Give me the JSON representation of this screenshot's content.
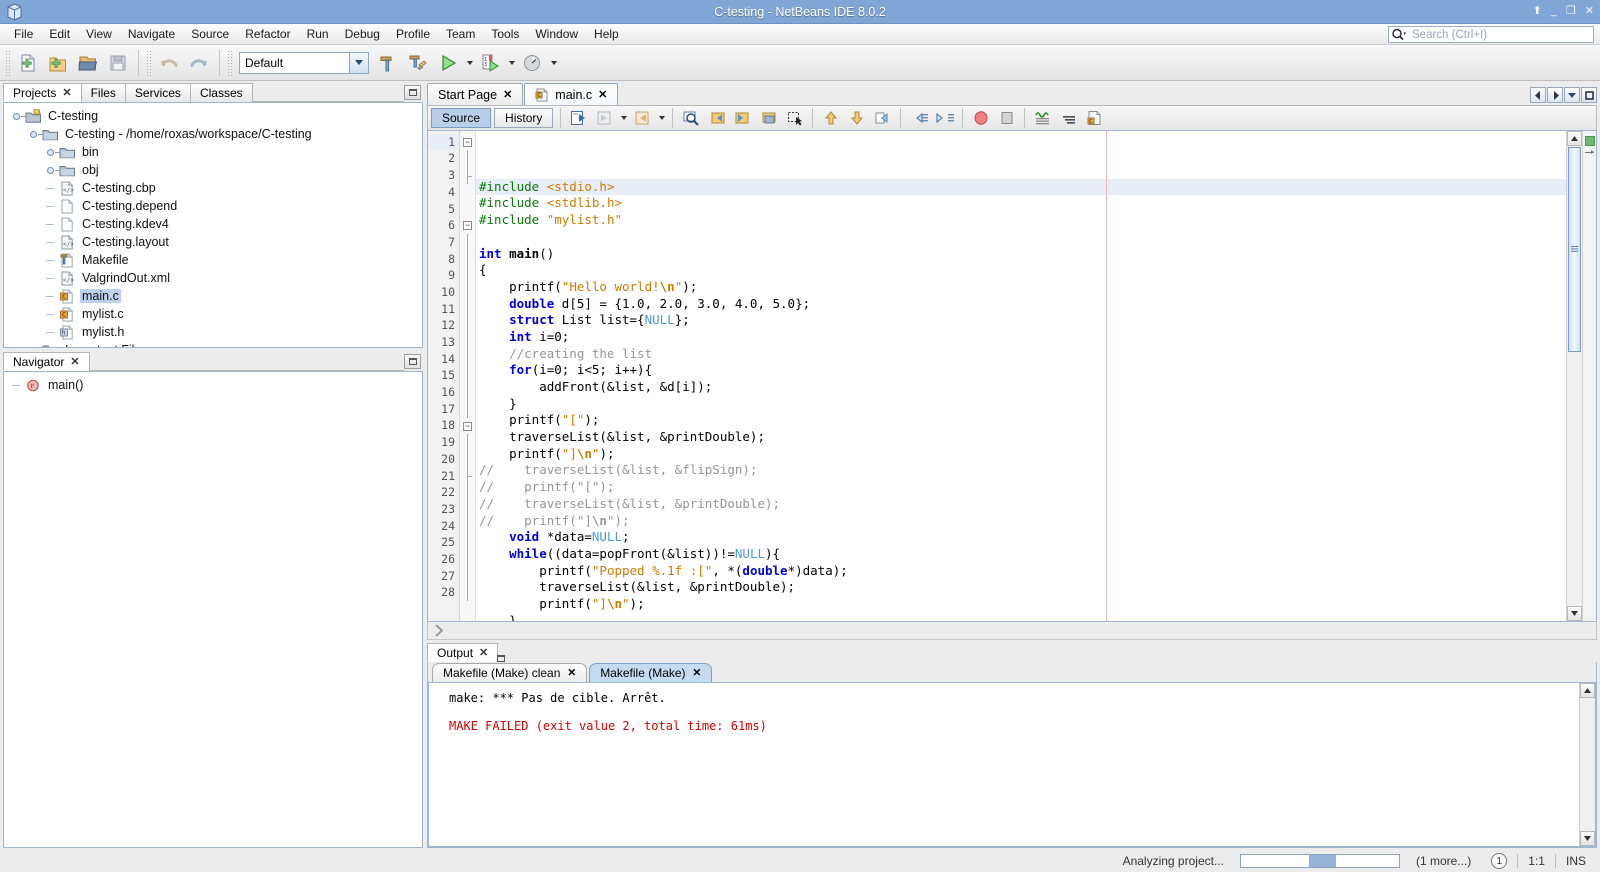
{
  "window": {
    "title": "C-testing - NetBeans IDE 8.0.2",
    "controls": {
      "up": "⬆",
      "minimize": "_",
      "restore": "❐",
      "close": "✕"
    }
  },
  "menubar": {
    "items": [
      {
        "label": "File",
        "mn": "F"
      },
      {
        "label": "Edit",
        "mn": "E"
      },
      {
        "label": "View",
        "mn": "V"
      },
      {
        "label": "Navigate",
        "mn": "N"
      },
      {
        "label": "Source",
        "mn": "S"
      },
      {
        "label": "Refactor",
        "mn": "a"
      },
      {
        "label": "Run",
        "mn": "R"
      },
      {
        "label": "Debug",
        "mn": "D"
      },
      {
        "label": "Profile",
        "mn": "P"
      },
      {
        "label": "Team",
        "mn": "m"
      },
      {
        "label": "Tools",
        "mn": "T"
      },
      {
        "label": "Window",
        "mn": "W"
      },
      {
        "label": "Help",
        "mn": "H"
      }
    ]
  },
  "search": {
    "placeholder": "Search (Ctrl+I)",
    "value": ""
  },
  "toolbar": {
    "config_combo": {
      "value": "Default"
    },
    "buttons": [
      {
        "name": "new-file",
        "tooltip": "New File"
      },
      {
        "name": "new-project",
        "tooltip": "New Project"
      },
      {
        "name": "open-project",
        "tooltip": "Open Project"
      },
      {
        "name": "save-all",
        "tooltip": "Save All"
      },
      {
        "name": "undo",
        "tooltip": "Undo"
      },
      {
        "name": "redo",
        "tooltip": "Redo"
      },
      {
        "name": "build-project",
        "tooltip": "Build Project"
      },
      {
        "name": "clean-and-build",
        "tooltip": "Clean and Build Project"
      },
      {
        "name": "run-project",
        "tooltip": "Run Project"
      },
      {
        "name": "debug-project",
        "tooltip": "Debug Project"
      },
      {
        "name": "profile-project",
        "tooltip": "Profile Project"
      }
    ]
  },
  "left": {
    "tabs": [
      {
        "label": "Projects",
        "closable": true,
        "selected": true
      },
      {
        "label": "Files",
        "closable": false,
        "selected": false
      },
      {
        "label": "Services",
        "closable": false,
        "selected": false
      },
      {
        "label": "Classes",
        "closable": false,
        "selected": false
      }
    ],
    "tree": [
      {
        "label": "C-testing",
        "depth": 0,
        "icon": "project-icon",
        "expander": "expanded",
        "selected": false
      },
      {
        "label": "C-testing - /home/roxas/workspace/C-testing",
        "depth": 1,
        "icon": "folder-icon",
        "expander": "expanded",
        "selected": false
      },
      {
        "label": "bin",
        "depth": 2,
        "icon": "folder-icon",
        "expander": "collapsed",
        "selected": false
      },
      {
        "label": "obj",
        "depth": 2,
        "icon": "folder-icon",
        "expander": "collapsed",
        "selected": false
      },
      {
        "label": "C-testing.cbp",
        "depth": 2,
        "icon": "xml-file-icon",
        "expander": "leaf",
        "selected": false
      },
      {
        "label": "C-testing.depend",
        "depth": 2,
        "icon": "plain-file-icon",
        "expander": "leaf",
        "selected": false
      },
      {
        "label": "C-testing.kdev4",
        "depth": 2,
        "icon": "plain-file-icon",
        "expander": "leaf",
        "selected": false
      },
      {
        "label": "C-testing.layout",
        "depth": 2,
        "icon": "xml-file-icon",
        "expander": "leaf",
        "selected": false
      },
      {
        "label": "Makefile",
        "depth": 2,
        "icon": "makefile-icon",
        "expander": "leaf",
        "selected": false
      },
      {
        "label": "ValgrindOut.xml",
        "depth": 2,
        "icon": "xml-file-icon",
        "expander": "leaf",
        "selected": false
      },
      {
        "label": "main.c",
        "depth": 2,
        "icon": "c-file-icon",
        "expander": "leaf",
        "selected": true
      },
      {
        "label": "mylist.c",
        "depth": 2,
        "icon": "c-file-icon",
        "expander": "leaf",
        "selected": false
      },
      {
        "label": "mylist.h",
        "depth": 2,
        "icon": "h-file-icon",
        "expander": "leaf",
        "selected": false
      },
      {
        "label": "Important Files",
        "depth": 1,
        "icon": "important-files-icon",
        "expander": "collapsed",
        "selected": false
      }
    ],
    "navigator": {
      "tab_label": "Navigator",
      "items": [
        {
          "label": "main()",
          "icon": "function-icon"
        }
      ]
    }
  },
  "editor": {
    "doc_tabs": [
      {
        "label": "Start Page",
        "selected": false,
        "icon": null
      },
      {
        "label": "main.c",
        "selected": true,
        "icon": "c-file-icon"
      }
    ],
    "view_buttons": [
      {
        "label": "Source",
        "active": true
      },
      {
        "label": "History",
        "active": false
      }
    ],
    "toolbar_icons": [
      "last-edit-icon",
      "back-icon",
      "forward-icon",
      "find-selection-icon",
      "previous-bookmark-icon",
      "next-bookmark-icon",
      "toggle-bookmark-icon",
      "toggle-rectangular-selection-icon",
      "previous-error-icon",
      "next-error-icon",
      "shift-line-right-icon",
      "comment-icon",
      "uncomment-icon",
      "toggle-breakpoint-icon",
      "stop-icon",
      "toggle-highlight-icon",
      "toggle-line-numbers-icon",
      "inspect-icon"
    ],
    "nav_buttons": [
      "scroll-left-icon",
      "scroll-right-icon",
      "tab-list-icon",
      "maximize-icon"
    ],
    "cursor_line": 1,
    "right_margin_column": 80,
    "lines": [
      {
        "n": 1,
        "fold": "start",
        "tokens": [
          {
            "t": "#include ",
            "c": "pp"
          },
          {
            "t": "<stdio.h>",
            "c": "str"
          }
        ]
      },
      {
        "n": 2,
        "fold": "mid",
        "tokens": [
          {
            "t": "#include ",
            "c": "pp"
          },
          {
            "t": "<stdlib.h>",
            "c": "str"
          }
        ]
      },
      {
        "n": 3,
        "fold": "end",
        "tokens": [
          {
            "t": "#include ",
            "c": "pp"
          },
          {
            "t": "\"mylist.h\"",
            "c": "str"
          }
        ]
      },
      {
        "n": 4,
        "fold": "",
        "tokens": []
      },
      {
        "n": 5,
        "fold": "",
        "tokens": [
          {
            "t": "int ",
            "c": "kw"
          },
          {
            "t": "main",
            "c": "bold"
          },
          {
            "t": "()",
            "c": ""
          }
        ]
      },
      {
        "n": 6,
        "fold": "start2",
        "tokens": [
          {
            "t": "{",
            "c": ""
          }
        ]
      },
      {
        "n": 7,
        "fold": "bar",
        "tokens": [
          {
            "t": "    printf(",
            "c": ""
          },
          {
            "t": "\"Hello world!",
            "c": "str"
          },
          {
            "t": "\\n",
            "c": "esc"
          },
          {
            "t": "\"",
            "c": "str"
          },
          {
            "t": ");",
            "c": ""
          }
        ]
      },
      {
        "n": 8,
        "fold": "bar",
        "tokens": [
          {
            "t": "    ",
            "c": ""
          },
          {
            "t": "double",
            "c": "kw"
          },
          {
            "t": " d[5] = {1.0, 2.0, 3.0, 4.0, 5.0};",
            "c": ""
          }
        ]
      },
      {
        "n": 9,
        "fold": "bar",
        "tokens": [
          {
            "t": "    ",
            "c": ""
          },
          {
            "t": "struct",
            "c": "kw"
          },
          {
            "t": " List list={",
            "c": ""
          },
          {
            "t": "NULL",
            "c": "mac"
          },
          {
            "t": "};",
            "c": ""
          }
        ]
      },
      {
        "n": 10,
        "fold": "bar",
        "tokens": [
          {
            "t": "    ",
            "c": ""
          },
          {
            "t": "int",
            "c": "kw"
          },
          {
            "t": " i=0;",
            "c": ""
          }
        ]
      },
      {
        "n": 11,
        "fold": "bar",
        "tokens": [
          {
            "t": "    //creating the list",
            "c": "cmt"
          }
        ]
      },
      {
        "n": 12,
        "fold": "bar",
        "tokens": [
          {
            "t": "    ",
            "c": ""
          },
          {
            "t": "for",
            "c": "kw"
          },
          {
            "t": "(i=0; i<5; i++){",
            "c": ""
          }
        ]
      },
      {
        "n": 13,
        "fold": "bar",
        "tokens": [
          {
            "t": "        addFront(&list, &d[i]);",
            "c": ""
          }
        ]
      },
      {
        "n": 14,
        "fold": "bar",
        "tokens": [
          {
            "t": "    }",
            "c": ""
          }
        ]
      },
      {
        "n": 15,
        "fold": "bar",
        "tokens": [
          {
            "t": "    printf(",
            "c": ""
          },
          {
            "t": "\"[\"",
            "c": "str"
          },
          {
            "t": ");",
            "c": ""
          }
        ]
      },
      {
        "n": 16,
        "fold": "bar",
        "tokens": [
          {
            "t": "    traverseList(&list, &printDouble);",
            "c": ""
          }
        ]
      },
      {
        "n": 17,
        "fold": "bar",
        "tokens": [
          {
            "t": "    printf(",
            "c": ""
          },
          {
            "t": "\"]",
            "c": "str"
          },
          {
            "t": "\\n",
            "c": "esc"
          },
          {
            "t": "\"",
            "c": "str"
          },
          {
            "t": ");",
            "c": ""
          }
        ]
      },
      {
        "n": 18,
        "fold": "start3",
        "tokens": [
          {
            "t": "//    traverseList(&list, &flipSign);",
            "c": "cmt"
          }
        ]
      },
      {
        "n": 19,
        "fold": "bar",
        "tokens": [
          {
            "t": "//    printf(\"[\");",
            "c": "cmt"
          }
        ]
      },
      {
        "n": 20,
        "fold": "bar",
        "tokens": [
          {
            "t": "//    traverseList(&list, &printDouble);",
            "c": "cmt"
          }
        ]
      },
      {
        "n": 21,
        "fold": "end3",
        "tokens": [
          {
            "t": "//    printf(\"]",
            "c": "cmt"
          },
          {
            "t": "\\n",
            "c": "cmtb"
          },
          {
            "t": "\");",
            "c": "cmt"
          }
        ]
      },
      {
        "n": 22,
        "fold": "bar",
        "tokens": [
          {
            "t": "    ",
            "c": ""
          },
          {
            "t": "void",
            "c": "kw"
          },
          {
            "t": " *data=",
            "c": ""
          },
          {
            "t": "NULL",
            "c": "mac"
          },
          {
            "t": ";",
            "c": ""
          }
        ]
      },
      {
        "n": 23,
        "fold": "bar",
        "tokens": [
          {
            "t": "    ",
            "c": ""
          },
          {
            "t": "while",
            "c": "kw"
          },
          {
            "t": "((data=popFront(&list))!=",
            "c": ""
          },
          {
            "t": "NULL",
            "c": "mac"
          },
          {
            "t": "){",
            "c": ""
          }
        ]
      },
      {
        "n": 24,
        "fold": "bar",
        "tokens": [
          {
            "t": "        printf(",
            "c": ""
          },
          {
            "t": "\"Popped %.1f :[\"",
            "c": "str"
          },
          {
            "t": ", *(",
            "c": ""
          },
          {
            "t": "double",
            "c": "kw"
          },
          {
            "t": "*)data);",
            "c": ""
          }
        ]
      },
      {
        "n": 25,
        "fold": "bar",
        "tokens": [
          {
            "t": "        traverseList(&list, &printDouble);",
            "c": ""
          }
        ]
      },
      {
        "n": 26,
        "fold": "bar",
        "tokens": [
          {
            "t": "        printf(",
            "c": ""
          },
          {
            "t": "\"]",
            "c": "str"
          },
          {
            "t": "\\n",
            "c": "esc"
          },
          {
            "t": "\"",
            "c": "str"
          },
          {
            "t": ");",
            "c": ""
          }
        ]
      },
      {
        "n": 27,
        "fold": "bar",
        "tokens": [
          {
            "t": "    }",
            "c": ""
          }
        ]
      },
      {
        "n": 28,
        "fold": "bar",
        "tokens": []
      }
    ]
  },
  "output": {
    "tab_label": "Output",
    "sub_tabs": [
      {
        "label": "Makefile (Make) clean",
        "selected": false
      },
      {
        "label": "Makefile (Make)",
        "selected": true
      }
    ],
    "lines": [
      {
        "text": "make: *** Pas de cible. Arrêt.",
        "error": false
      },
      {
        "text": "",
        "error": false
      },
      {
        "text": "MAKE FAILED (exit value 2, total time: 61ms)",
        "error": true
      }
    ]
  },
  "statusbar": {
    "progress_label": "Analyzing project...",
    "progress_percent": 55,
    "more_label": "(1 more...)",
    "notification_count": "1",
    "caret_position": "1:1",
    "insert_mode": "INS"
  },
  "colors": {
    "titlebar": "#80a6d8",
    "selection": "#bcd2ee",
    "error_text": "#dd0000",
    "keyword": "#0000e6",
    "string": "#ce7b00",
    "comment": "#969696",
    "preprocessor": "#0a7a0a",
    "macro": "#4a9ed6",
    "accent_tab": "#c5dcf0"
  }
}
